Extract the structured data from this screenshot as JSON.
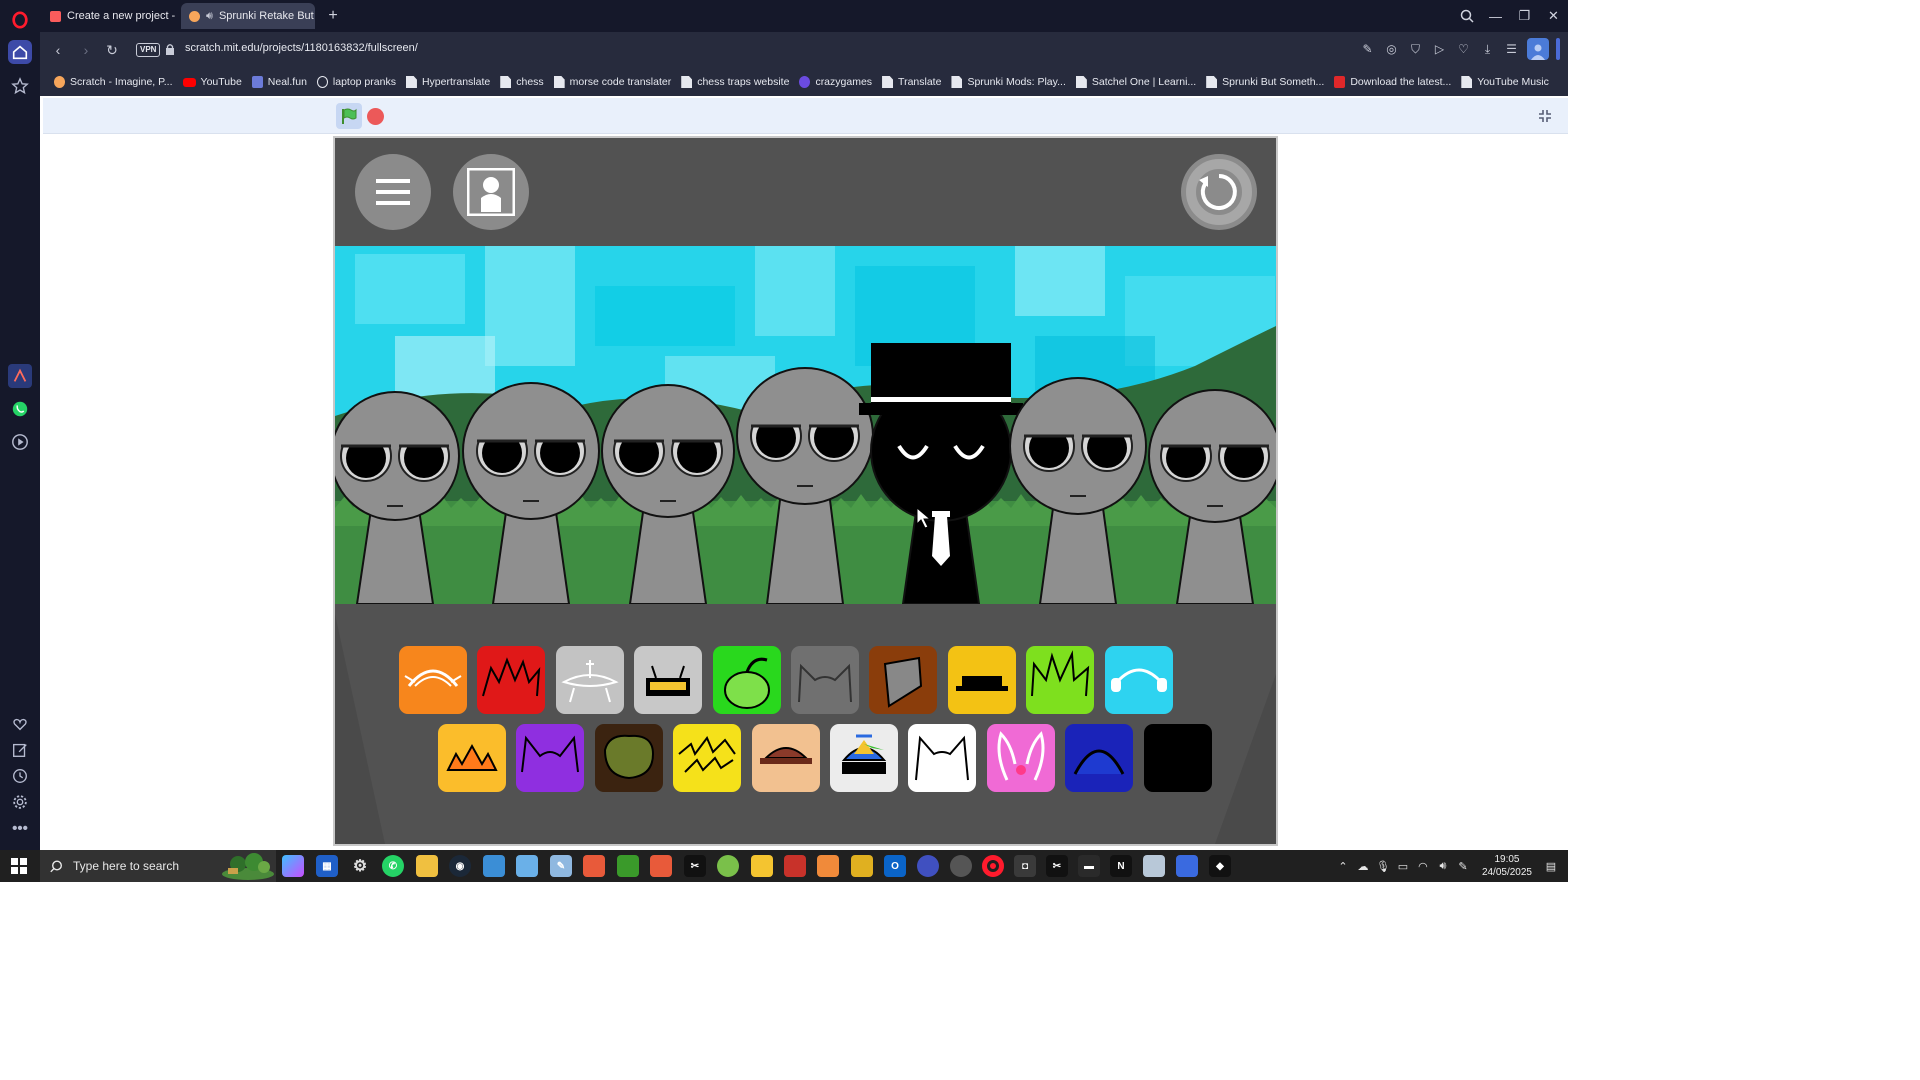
{
  "browser": {
    "tabs": [
      {
        "title": "Create a new project - itch",
        "active": false,
        "favicon_color": "#fa5c5c"
      },
      {
        "title": "Sprunki Retake But be",
        "active": true,
        "favicon_color": "#f7a65b",
        "audio_icon": "speaker-icon"
      }
    ],
    "new_tab_label": "+",
    "url": "scratch.mit.edu/projects/1180163832/fullscreen/",
    "vpn_label": "VPN",
    "bookmarks": [
      {
        "label": "Scratch - Imagine, P...",
        "icon": "scratch-icon"
      },
      {
        "label": "YouTube",
        "icon": "youtube-icon"
      },
      {
        "label": "Neal.fun",
        "icon": "nealfun-icon"
      },
      {
        "label": "laptop pranks",
        "icon": "globe-icon"
      },
      {
        "label": "Hypertranslate",
        "icon": "doc-icon"
      },
      {
        "label": "chess",
        "icon": "doc-icon"
      },
      {
        "label": "morse code translater",
        "icon": "doc-icon"
      },
      {
        "label": "chess traps website",
        "icon": "doc-icon"
      },
      {
        "label": "crazygames",
        "icon": "crazygames-icon"
      },
      {
        "label": "Translate",
        "icon": "doc-icon"
      },
      {
        "label": "Sprunki Mods: Play...",
        "icon": "doc-icon"
      },
      {
        "label": "Satchel One | Learni...",
        "icon": "doc-icon"
      },
      {
        "label": "Sprunki But Someth...",
        "icon": "doc-icon"
      },
      {
        "label": "Download the latest...",
        "icon": "download-site-icon"
      },
      {
        "label": "YouTube Music",
        "icon": "doc-icon"
      }
    ]
  },
  "scratch": {
    "green_flag": "green-flag-icon",
    "stop": "stop-icon",
    "unfullscreen": "unfullscreen-icon"
  },
  "game": {
    "menu_button": "menu-icon",
    "character_button": "character-portrait-icon",
    "reset_button": "reset-icon",
    "characters": [
      {
        "type": "gray"
      },
      {
        "type": "gray"
      },
      {
        "type": "gray"
      },
      {
        "type": "gray"
      },
      {
        "type": "black-tophat"
      },
      {
        "type": "gray"
      },
      {
        "type": "gray"
      }
    ],
    "icon_rows": [
      [
        {
          "name": "orange-crab-sound-icon",
          "color": "#f7861c"
        },
        {
          "name": "red-spiky-sound-icon",
          "color": "#e01818"
        },
        {
          "name": "gray-dish-sound-icon",
          "color": "#c3c3c3"
        },
        {
          "name": "gray-robot-sound-icon",
          "color": "#c8c8c8"
        },
        {
          "name": "green-pumpkin-sound-icon",
          "color": "#29d81d"
        },
        {
          "name": "gray-cat-ears-sound-icon",
          "color": "#707070"
        },
        {
          "name": "brown-bucket-sound-icon",
          "color": "#8a3d0b"
        },
        {
          "name": "yellow-hat-sound-icon",
          "color": "#f3c214"
        },
        {
          "name": "lime-spiky-sound-icon",
          "color": "#7ee01e"
        },
        {
          "name": "cyan-headphones-sound-icon",
          "color": "#2ed3f0"
        }
      ],
      [
        {
          "name": "orange-sun-sound-icon",
          "color": "#fbbd2b"
        },
        {
          "name": "purple-horns-sound-icon",
          "color": "#8f2fe0"
        },
        {
          "name": "dark-brown-bush-sound-icon",
          "color": "#3b2310"
        },
        {
          "name": "yellow-lightning-sound-icon",
          "color": "#f5e11a"
        },
        {
          "name": "tan-cap-sound-icon",
          "color": "#f2c190"
        },
        {
          "name": "propeller-hat-sound-icon",
          "color": "#ececec"
        },
        {
          "name": "white-cat-sound-icon",
          "color": "#ffffff"
        },
        {
          "name": "pink-bunny-sound-icon",
          "color": "#f06ad5"
        },
        {
          "name": "blue-dome-sound-icon",
          "color": "#1a23b9"
        },
        {
          "name": "black-tophat-sound-icon",
          "color": "#000000"
        }
      ]
    ]
  },
  "taskbar": {
    "search_placeholder": "Type here to search",
    "time": "19:05",
    "date": "24/05/2025"
  }
}
